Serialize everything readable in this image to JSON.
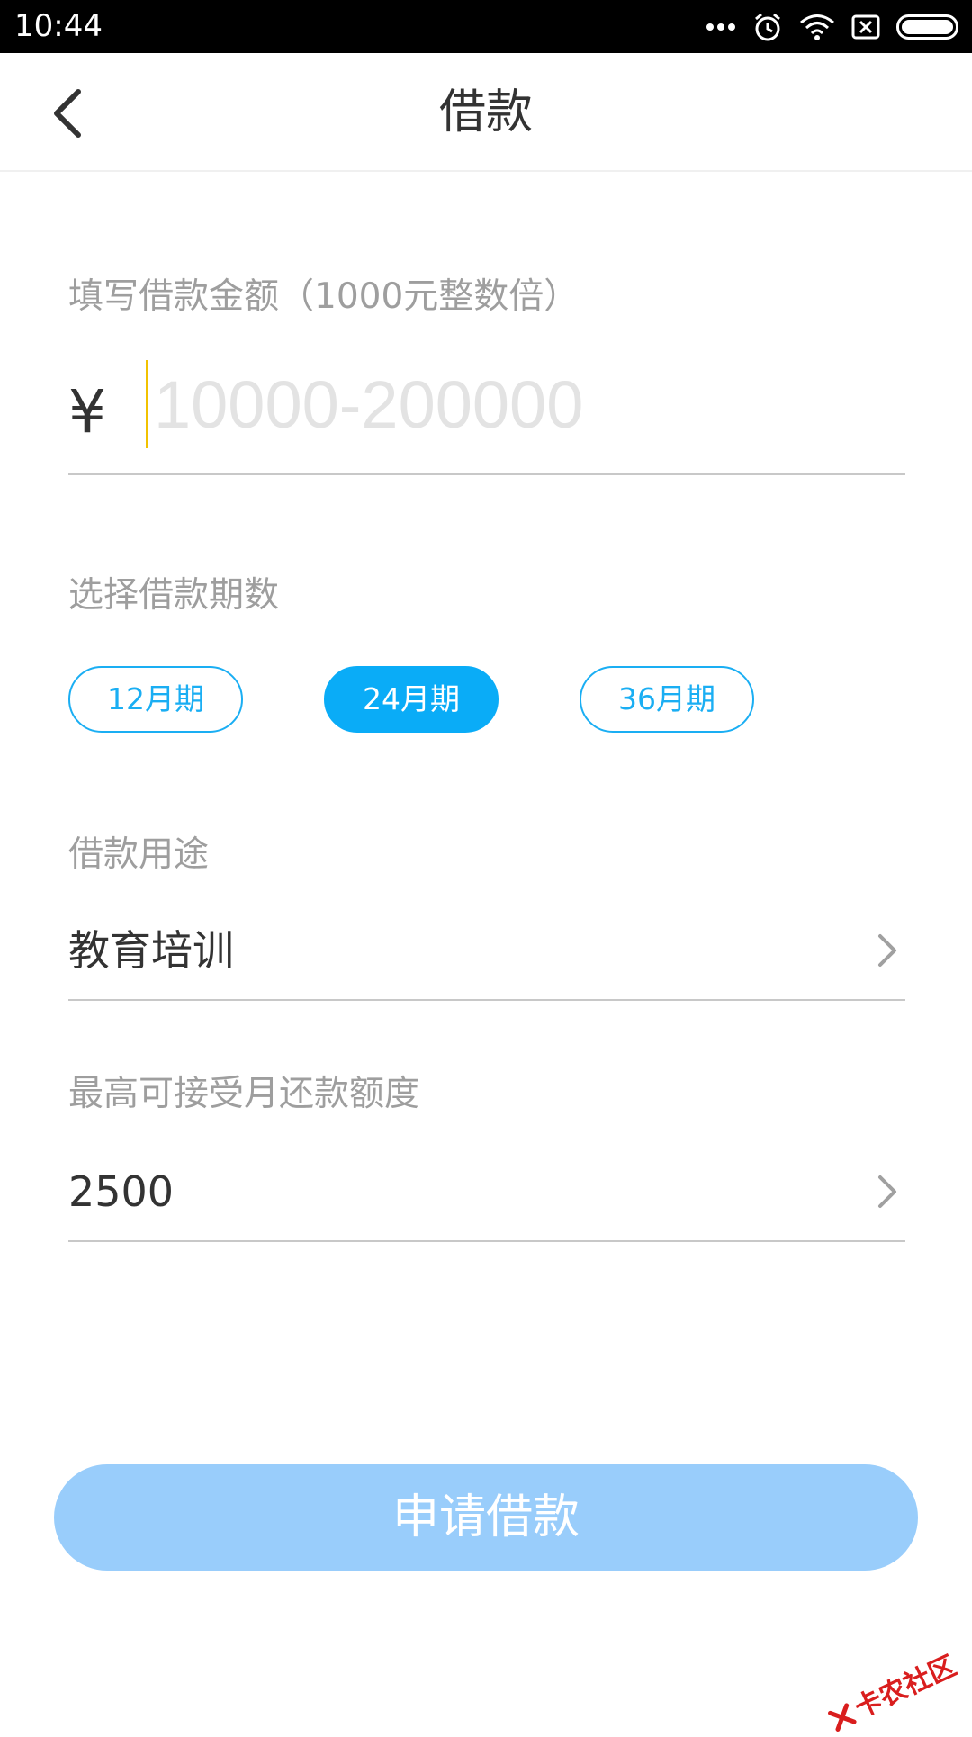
{
  "status_bar": {
    "time": "10:44"
  },
  "header": {
    "title": "借款"
  },
  "amount": {
    "label": "填写借款金额（1000元整数倍）",
    "currency": "¥",
    "placeholder": "10000-200000",
    "value": ""
  },
  "term": {
    "label": "选择借款期数",
    "options": [
      "12月期",
      "24月期",
      "36月期"
    ],
    "selected": "24月期"
  },
  "purpose": {
    "label": "借款用途",
    "value": "教育培训"
  },
  "repayment": {
    "label": "最高可接受月还款额度",
    "value": "2500"
  },
  "submit": {
    "label": "申请借款"
  },
  "watermark": {
    "text": "卡农社区"
  },
  "colors": {
    "accent": "#0aacf7",
    "submit_disabled": "#99cdfb",
    "cursor": "#f2c200",
    "watermark": "#d91e1e"
  }
}
